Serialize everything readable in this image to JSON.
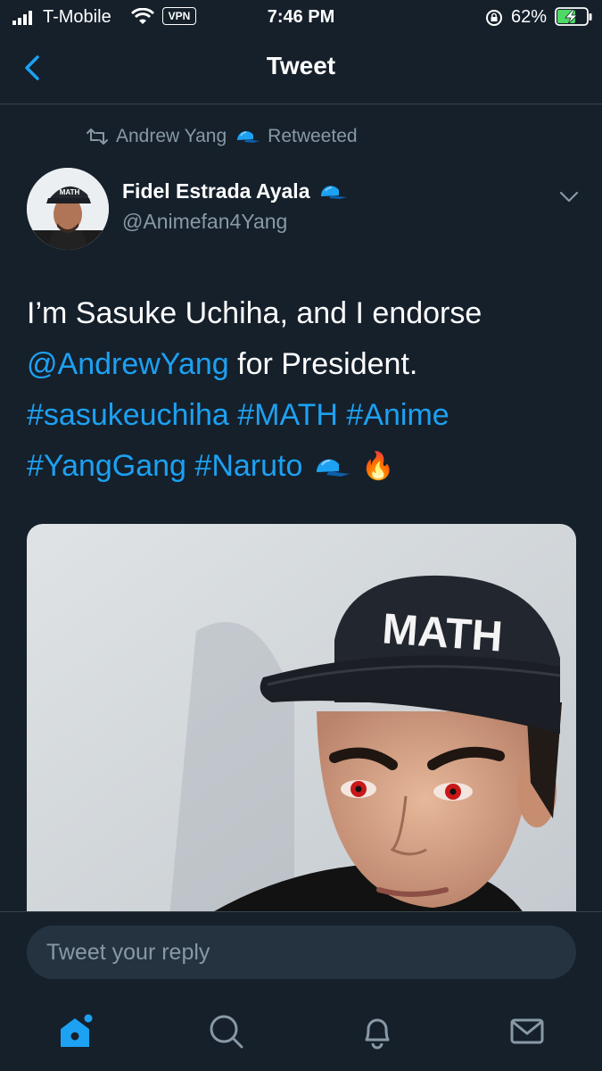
{
  "status_bar": {
    "carrier": "T-Mobile",
    "vpn": "VPN",
    "time": "7:46 PM",
    "battery": "62%"
  },
  "header": {
    "title": "Tweet",
    "back_icon": "chevron-left-icon"
  },
  "retweet": {
    "icon": "retweet-icon",
    "retweeter": "Andrew Yang",
    "suffix": "Retweeted"
  },
  "author": {
    "name": "Fidel Estrada Ayala",
    "handle": "@Animefan4Yang",
    "hat_text": "MATH"
  },
  "tweet": {
    "line1": "I’m Sasuke Uchiha, and I endorse",
    "mention": "@AndrewYang",
    "line2_rest": " for President.",
    "hashtags_row1": "#sasukeuchiha #MATH #Anime",
    "hashtags_row2": "#YangGang #Naruto",
    "emoji_fire": "🔥"
  },
  "media": {
    "hat_text": "MATH"
  },
  "reply": {
    "placeholder": "Tweet your reply"
  },
  "tabbar": {
    "items": [
      "home-icon",
      "search-icon",
      "notifications-icon",
      "messages-icon"
    ]
  },
  "colors": {
    "background": "#15202b",
    "accent": "#1da1f2",
    "secondary_text": "#8899a6",
    "divider": "#38444d"
  }
}
